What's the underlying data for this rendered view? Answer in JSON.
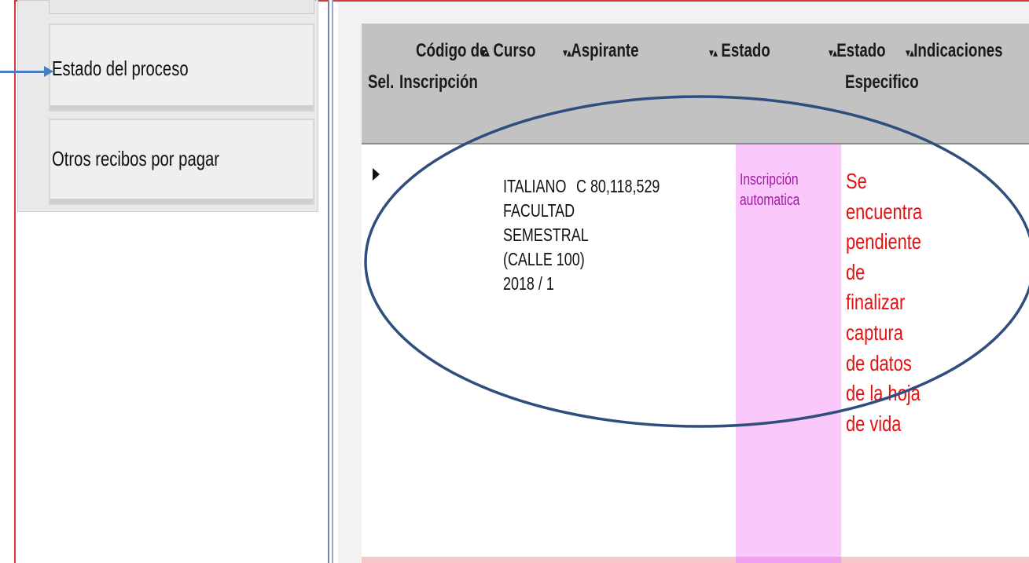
{
  "sidebar": {
    "items": [
      {
        "label": "Estado del proceso"
      },
      {
        "label": "Otros recibos por pagar"
      }
    ]
  },
  "table": {
    "columns": {
      "sel": "Sel.",
      "codigo_line1": "Código de",
      "codigo_line2": "Inscripción",
      "curso": "Curso",
      "aspirante": "Aspirante",
      "estado": "Estado",
      "estado_especifico_line1": "Estado",
      "estado_especifico_line2": "Especifico",
      "indicaciones": "Indicaciones"
    },
    "sort_glyph": "▾▴",
    "row": {
      "curso_lines": [
        "ITALIANO",
        "FACULTAD",
        "SEMESTRAL",
        "(CALLE 100)",
        "2018 / 1"
      ],
      "aspirante": "C 80,118,529",
      "estado_lines": [
        "Inscripción",
        "automatica"
      ],
      "estado_especifico_lines": [
        "Se",
        "encuentra",
        "pendiente",
        "de",
        "finalizar",
        "captura",
        "de datos",
        "de la hoja",
        "de vida"
      ]
    }
  },
  "colors": {
    "annotation": "#2f4d7d",
    "arrow": "#4a7ec2",
    "estado_bg": "#fac8fa",
    "alert_text": "#e61010",
    "header_bg": "#c2c2c2"
  }
}
